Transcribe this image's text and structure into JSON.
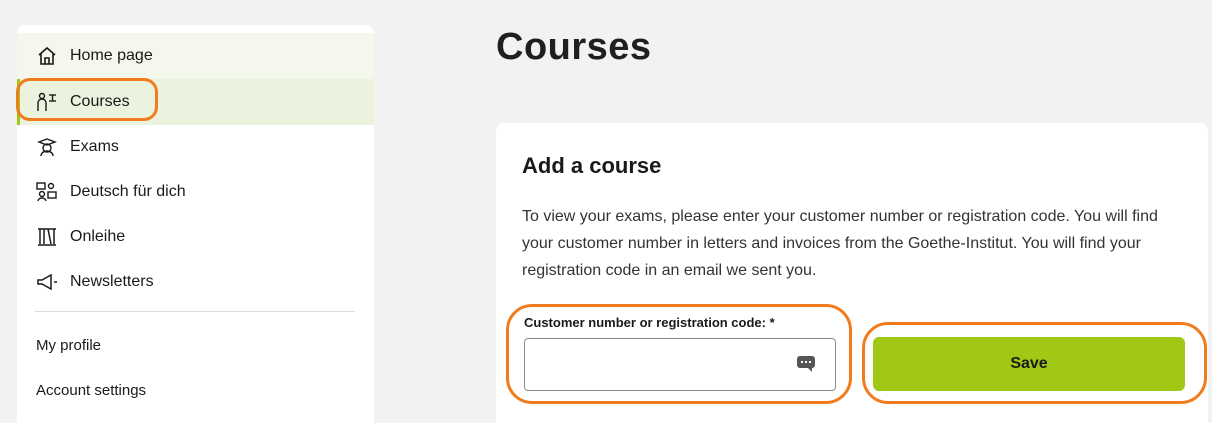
{
  "sidebar": {
    "nav_items": [
      {
        "label": "Home page",
        "icon": "house-icon"
      },
      {
        "label": "Courses",
        "icon": "students-icon"
      },
      {
        "label": "Exams",
        "icon": "graduate-icon"
      },
      {
        "label": "Deutsch für dich",
        "icon": "people-chat-icon"
      },
      {
        "label": "Onleihe",
        "icon": "bookshelf-icon"
      },
      {
        "label": "Newsletters",
        "icon": "megaphone-icon"
      }
    ],
    "sub_items": [
      {
        "label": "My profile"
      },
      {
        "label": "Account settings"
      }
    ]
  },
  "main": {
    "title": "Courses",
    "card": {
      "title": "Add a course",
      "description": "To view your exams, please enter your customer number or registration code. You will find your customer number in letters and invoices from the Goethe-Institut. You will find your registration code in an email we sent you.",
      "field_label": "Customer number or registration code: *",
      "field_value": "",
      "save_label": "Save"
    }
  },
  "colors": {
    "accent": "#a0c814",
    "annotation": "#f07c1e",
    "active_bg": "#ebf2de"
  }
}
